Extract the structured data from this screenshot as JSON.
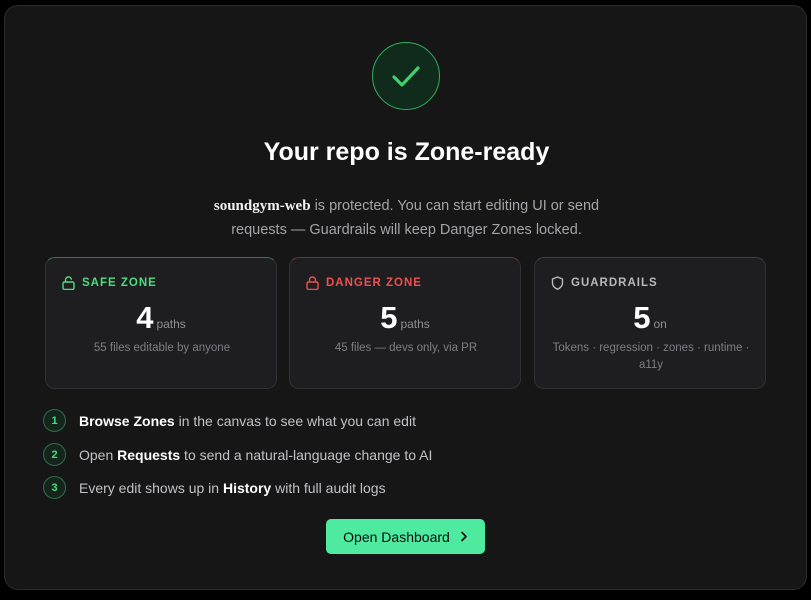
{
  "hero": {
    "title": "Your repo is Zone-ready",
    "repo_name": "soundgym-web",
    "subtitle_rest": " is protected. You can start editing UI or send requests — Guardrails will keep Danger Zones locked."
  },
  "cards": [
    {
      "label": "SAFE ZONE",
      "value": "4",
      "unit": "paths",
      "description": "55 files editable by anyone",
      "icon": "unlocked-lock-icon",
      "color": "#4ade80"
    },
    {
      "label": "DANGER ZONE",
      "value": "5",
      "unit": "paths",
      "description": "45 files — devs only, via PR",
      "icon": "lock-icon",
      "color": "#ef4f4f"
    },
    {
      "label": "GUARDRAILS",
      "value": "5",
      "unit": "on",
      "description": "Tokens · regression · zones · runtime · a11y",
      "icon": "shield-icon",
      "color": "#b8b8bc"
    }
  ],
  "steps": [
    {
      "num": "1",
      "bold": "Browse Zones",
      "rest": " in the canvas to see what you can edit"
    },
    {
      "num": "2",
      "pre": "Open ",
      "bold": "Requests",
      "rest": " to send a natural-language change to AI"
    },
    {
      "num": "3",
      "pre": "Every edit shows up in ",
      "bold": "History",
      "rest": " with full audit logs"
    }
  ],
  "cta": {
    "label": "Open Dashboard",
    "icon": "chevron-right-icon",
    "color": "#4eeaa0"
  },
  "status_icon": "check-icon",
  "accent": "#4ade80"
}
